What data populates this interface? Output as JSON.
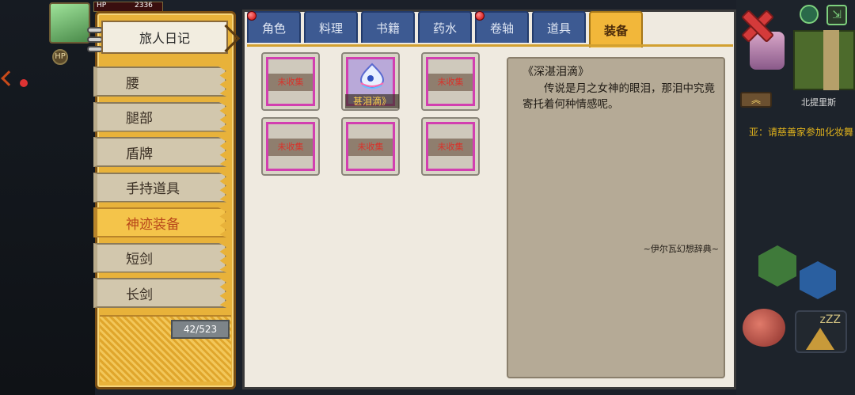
{
  "hud": {
    "hp_label": "HP",
    "hp_value": "2336",
    "level_badge": "HP",
    "map_name": "北提里斯",
    "scroll_message": "亚：请慈善家参加化妆舞",
    "up_arrow": "︽",
    "exit_symbol": "⇲",
    "sleep_symbol": "zZZ"
  },
  "journal": {
    "title": "旅人日记",
    "categories": [
      {
        "label": "腰",
        "active": false
      },
      {
        "label": "腿部",
        "active": false
      },
      {
        "label": "盾牌",
        "active": false
      },
      {
        "label": "手持道具",
        "active": false
      },
      {
        "label": "神迹装备",
        "active": true
      },
      {
        "label": "短剑",
        "active": false
      },
      {
        "label": "长剑",
        "active": false
      }
    ],
    "counter": "42/523"
  },
  "tabs": [
    {
      "label": "角色",
      "notif": true,
      "active": false
    },
    {
      "label": "料理",
      "notif": false,
      "active": false
    },
    {
      "label": "书籍",
      "notif": false,
      "active": false
    },
    {
      "label": "药水",
      "notif": false,
      "active": false
    },
    {
      "label": "卷轴",
      "notif": true,
      "active": false
    },
    {
      "label": "道具",
      "notif": false,
      "active": false
    },
    {
      "label": "装备",
      "notif": false,
      "active": true
    }
  ],
  "slots": [
    {
      "label": "未收集",
      "collected": false
    },
    {
      "label": "甚泪滴》",
      "collected": true
    },
    {
      "label": "未收集",
      "collected": false
    },
    {
      "label": "未收集",
      "collected": false
    },
    {
      "label": "未收集",
      "collected": false
    },
    {
      "label": "未收集",
      "collected": false
    }
  ],
  "detail": {
    "title": "《深湛泪滴》",
    "body": "传说是月之女神的眼泪，那泪中究竟寄托着何种情感呢。",
    "source": "~伊尔瓦幻想辞典~"
  },
  "colors": {
    "accent": "#f2b73a",
    "tab_blue": "#3d5a92",
    "uncollected_text": "#d9322a",
    "rarity_border": "#d23fb0"
  }
}
